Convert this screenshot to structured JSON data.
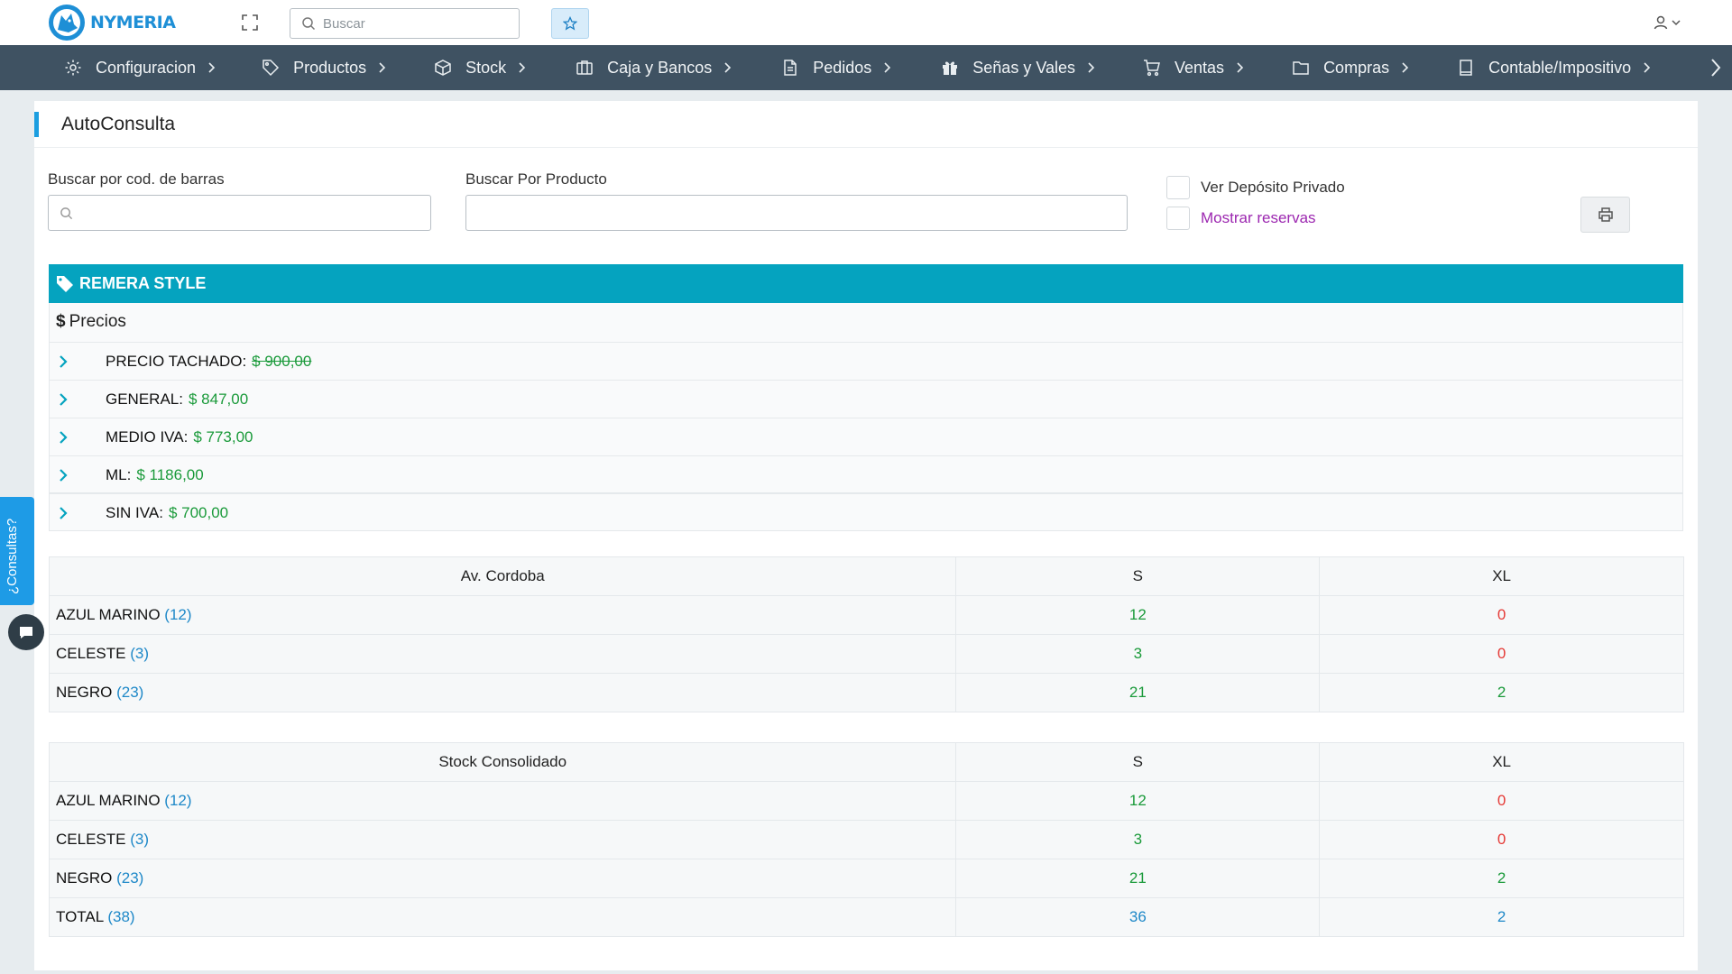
{
  "app": {
    "brand": "NYMERIA",
    "search_placeholder": "Buscar"
  },
  "nav": [
    {
      "label": "Configuracion",
      "icon": "gear-icon"
    },
    {
      "label": "Productos",
      "icon": "tag-icon"
    },
    {
      "label": "Stock",
      "icon": "box-icon"
    },
    {
      "label": "Caja y Bancos",
      "icon": "bank-icon"
    },
    {
      "label": "Pedidos",
      "icon": "document-icon"
    },
    {
      "label": "Señas y Vales",
      "icon": "gift-icon"
    },
    {
      "label": "Ventas",
      "icon": "cart-icon"
    },
    {
      "label": "Compras",
      "icon": "folder-icon"
    },
    {
      "label": "Contable/Impositivo",
      "icon": "book-icon"
    }
  ],
  "page": {
    "title": "AutoConsulta",
    "barcode_label": "Buscar por cod. de barras",
    "product_label": "Buscar Por Producto",
    "chk_private": "Ver Depósito Privado",
    "chk_reservas": "Mostrar reservas"
  },
  "product": {
    "name": "REMERA STYLE",
    "prices_title": "Precios",
    "prices": [
      {
        "name": "PRECIO TACHADO:",
        "value": "$ 900,00",
        "strike": true
      },
      {
        "name": "GENERAL:",
        "value": "$ 847,00",
        "strike": false
      },
      {
        "name": "MEDIO IVA:",
        "value": "$ 773,00",
        "strike": false
      },
      {
        "name": "ML:",
        "value": "$ 1186,00",
        "strike": false
      },
      {
        "name": "SIN IVA:",
        "value": "$ 700,00",
        "strike": false
      }
    ]
  },
  "tables": {
    "branch": {
      "header": [
        "Av. Cordoba",
        "S",
        "XL"
      ],
      "rows": [
        {
          "name": "AZUL MARINO",
          "count": "(12)",
          "s": "12",
          "xl": "0"
        },
        {
          "name": "CELESTE",
          "count": "(3)",
          "s": "3",
          "xl": "0"
        },
        {
          "name": "NEGRO",
          "count": "(23)",
          "s": "21",
          "xl": "2"
        }
      ]
    },
    "consolidated": {
      "header": [
        "Stock Consolidado",
        "S",
        "XL"
      ],
      "rows": [
        {
          "name": "AZUL MARINO",
          "count": "(12)",
          "s": "12",
          "xl": "0"
        },
        {
          "name": "CELESTE",
          "count": "(3)",
          "s": "3",
          "xl": "0"
        },
        {
          "name": "NEGRO",
          "count": "(23)",
          "s": "21",
          "xl": "2"
        },
        {
          "name": "TOTAL",
          "count": "(38)",
          "s": "36",
          "xl": "2"
        }
      ]
    }
  },
  "side": {
    "consultas": "¿Consultas?"
  },
  "colors": {
    "nav_bg": "#3f5262",
    "accent": "#1b9ee0",
    "product_header": "#05a3bf",
    "price_green": "#1a9a3a",
    "zero_red": "#e53935",
    "count_blue": "#1e88c8",
    "reservas_purple": "#9c27b0"
  }
}
